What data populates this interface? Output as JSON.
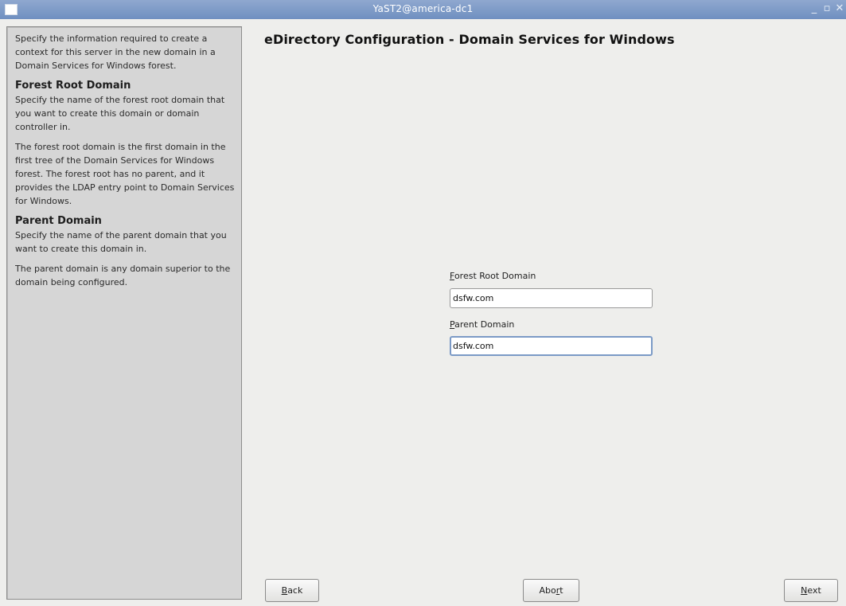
{
  "window": {
    "title": "YaST2@america-dc1",
    "min_glyph": "_",
    "max_glyph": "▫",
    "close_glyph": "✕"
  },
  "help": {
    "intro": "Specify the information required to create a context for this server in the new domain in a Domain Services for Windows forest.",
    "forest_heading": "Forest Root Domain",
    "forest_p1": "Specify the name of the forest root domain that you want to create this domain or domain controller in.",
    "forest_p2": "The forest root domain is the first domain in the first tree of the Domain Services for Windows forest. The forest root has no parent, and it provides the LDAP entry point to Domain Services for Windows.",
    "parent_heading": "Parent Domain",
    "parent_p1": "Specify the name of the parent domain that you want to create this domain in.",
    "parent_p2": "The parent domain is any domain superior to the domain being configured."
  },
  "main": {
    "heading": "eDirectory Configuration - Domain Services for Windows",
    "forest_label_first": "F",
    "forest_label_rest": "orest Root Domain",
    "forest_value": "dsfw.com",
    "parent_label_first": "P",
    "parent_label_rest": "arent Domain",
    "parent_value": "dsfw.com"
  },
  "buttons": {
    "back_first": "B",
    "back_rest": "ack",
    "abort_head": "Abo",
    "abort_mnemonic": "r",
    "abort_tail": "t",
    "next_first": "N",
    "next_rest": "ext"
  }
}
